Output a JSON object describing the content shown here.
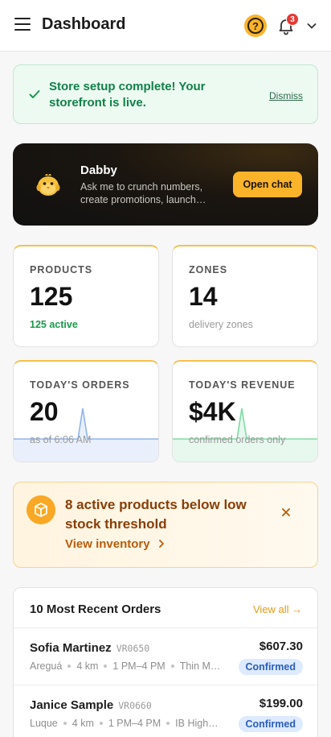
{
  "header": {
    "title": "Dashboard",
    "notification_count": "3"
  },
  "banner": {
    "message": "Store setup complete! Your storefront is live.",
    "dismiss_label": "Dismiss"
  },
  "assistant": {
    "name": "Dabby",
    "description": "Ask me to crunch numbers, create promotions, launch…",
    "button_label": "Open chat"
  },
  "stats": {
    "products": {
      "label": "PRODUCTS",
      "value": "125",
      "sub": "125 active"
    },
    "zones": {
      "label": "ZONES",
      "value": "14",
      "sub": "delivery zones"
    },
    "orders": {
      "label": "TODAY'S ORDERS",
      "value": "20",
      "sub": "as of 6:06 AM"
    },
    "revenue": {
      "label": "TODAY'S REVENUE",
      "value": "$4K",
      "sub": "confirmed orders only"
    }
  },
  "stock_alert": {
    "message": "8 active products below low stock threshold",
    "link_label": "View inventory"
  },
  "recent_orders": {
    "title": "10 Most Recent Orders",
    "view_all_label": "View all →",
    "rows": [
      {
        "name": "Sofia Martinez",
        "id": "VR0650",
        "city": "Areguá",
        "distance": "4 km",
        "window": "1 PM–4 PM",
        "product": "Thin Mi…",
        "amount": "$607.30",
        "status": "Confirmed"
      },
      {
        "name": "Janice Sample",
        "id": "VR0660",
        "city": "Luque",
        "distance": "4 km",
        "window": "1 PM–4 PM",
        "product": "IB High …",
        "amount": "$199.00",
        "status": "Confirmed"
      }
    ]
  },
  "colors": {
    "accent": "#fbb32a",
    "success": "#11804a",
    "orders_spark": "#8fb4ec",
    "revenue_spark": "#7fdca3"
  }
}
